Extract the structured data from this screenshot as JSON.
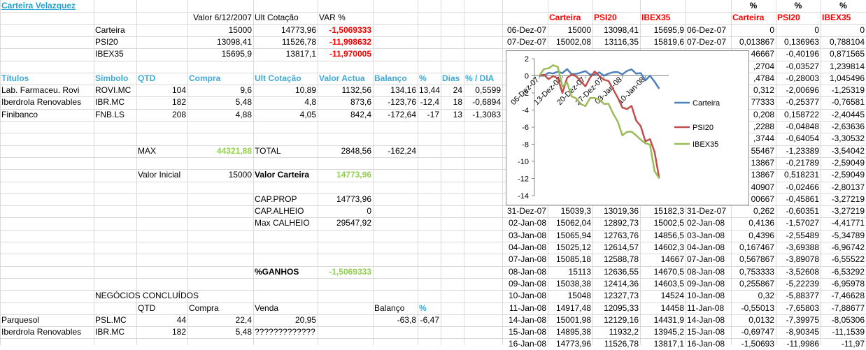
{
  "title": "Carteira Velazquez",
  "portfolio_header": {
    "valor_label": "Valor 6/12/2007",
    "ult_label": "Ult Cotação",
    "var_label": "VAR %"
  },
  "portfolio": [
    {
      "name": "Carteira",
      "valor": "15000",
      "ult": "14773,96",
      "var": "-1,5069333"
    },
    {
      "name": "PSI20",
      "valor": "13098,41",
      "ult": "11526,78",
      "var": "-11,998632"
    },
    {
      "name": "IBEX35",
      "valor": "15695,9",
      "ult": "13817,1",
      "var": "-11,970005"
    }
  ],
  "titulos_header": [
    "Títulos",
    "Símbolo",
    "QTD",
    "Compra",
    "Ult Cotação",
    "Valor Actua",
    "Balanço",
    "%",
    "Dias",
    "% / DIA"
  ],
  "titulos": [
    [
      "Lab. Farmaceu. Rovi",
      "ROVI.MC",
      "104",
      "9,6",
      "10,89",
      "1132,56",
      "134,16",
      "13,44",
      "24",
      "0,5599"
    ],
    [
      "Iberdrola Renovables",
      "IBR.MC",
      "182",
      "5,48",
      "4,8",
      "873,6",
      "-123,76",
      "-12,4",
      "18",
      "-0,6894"
    ],
    [
      "Finibanco",
      "FNB.LS",
      "208",
      "4,88",
      "4,05",
      "842,4",
      "-172,64",
      "-17",
      "13",
      "-1,3083"
    ]
  ],
  "max": {
    "label": "MAX",
    "value": "44321,88",
    "total_label": "TOTAL",
    "total": "2848,56",
    "total_bal": "-162,24"
  },
  "valor_inicial": {
    "label": "Valor Inicial",
    "value": "15000",
    "carteira_label": "Valor Carteira",
    "carteira": "14773,96"
  },
  "cap": [
    {
      "label": "CAP.PROP",
      "value": "14773,96"
    },
    {
      "label": "CAP.ALHEIO",
      "value": "0"
    },
    {
      "label": "Max CALHEIO",
      "value": "29547,92"
    }
  ],
  "ganhos": {
    "label": "%GANHOS",
    "value": "-1,5069333"
  },
  "negocios": {
    "title": "NEGÓCIOS CONCLUÍDOS",
    "header": {
      "qtd": "QTD",
      "compra": "Compra",
      "venda": "Venda",
      "balanco": "Balanço",
      "pct": "%"
    },
    "rows": [
      {
        "name": "Parquesol",
        "sym": "PSL.MC",
        "qtd": "44",
        "compra": "22,4",
        "venda": "20,95",
        "balanco": "-63,8",
        "pct": "-6,47"
      },
      {
        "name": "Iberdrola Renovables",
        "sym": "IBR.MC",
        "qtd": "182",
        "compra": "5,48",
        "venda": "?????????????",
        "balanco": "",
        "pct": ""
      }
    ]
  },
  "right_header": {
    "carteira": "Carteira",
    "psi20": "PSI20",
    "ibex35": "IBEX35",
    "pct": "%",
    "pcarteira": "Carteira",
    "ppsi20": "PSI20",
    "pibex35": "IBEX35"
  },
  "right_rows": [
    {
      "date": "06-Dez-07",
      "c": "15000",
      "p": "13098,41",
      "i": "15695,9",
      "date2": "06-Dez-07",
      "pc": "0",
      "pp": "0",
      "pi": "0"
    },
    {
      "date": "07-Dez-07",
      "c": "15002,08",
      "p": "13116,35",
      "i": "15819,6",
      "date2": "07-Dez-07",
      "pc": "0,013867",
      "pp": "0,136963",
      "pi": "0,788104"
    },
    {
      "date": "",
      "c": "",
      "p": "",
      "i": "",
      "date2": "",
      "pc": "46667",
      "pp": "-0,40196",
      "pi": "0,871565"
    },
    {
      "date": "",
      "c": "",
      "p": "",
      "i": "",
      "date2": "",
      "pc": ",2704",
      "pp": "-0,03527",
      "pi": "1,239814"
    },
    {
      "date": "",
      "c": "",
      "p": "",
      "i": "",
      "date2": "",
      "pc": ",4784",
      "pp": "-0,28003",
      "pi": "1,045496"
    },
    {
      "date": "",
      "c": "",
      "p": "",
      "i": "",
      "date2": "",
      "pc": "0,312",
      "pp": "-2,00696",
      "pi": "-1,25319"
    },
    {
      "date": "",
      "c": "",
      "p": "",
      "i": "",
      "date2": "",
      "pc": "77333",
      "pp": "-0,25377",
      "pi": "-0,76581"
    },
    {
      "date": "",
      "c": "",
      "p": "",
      "i": "",
      "date2": "",
      "pc": "0,208",
      "pp": "0,158722",
      "pi": "-2,40445"
    },
    {
      "date": "",
      "c": "",
      "p": "",
      "i": "",
      "date2": "",
      "pc": ",2288",
      "pp": "-0,04848",
      "pi": "-2,63636"
    },
    {
      "date": "",
      "c": "",
      "p": "",
      "i": "",
      "date2": "",
      "pc": ",3744",
      "pp": "-0,64054",
      "pi": "-3,30532"
    },
    {
      "date": "",
      "c": "",
      "p": "",
      "i": "",
      "date2": "",
      "pc": "55467",
      "pp": "-1,23389",
      "pi": "-3,54042"
    },
    {
      "date": "",
      "c": "",
      "p": "",
      "i": "",
      "date2": "",
      "pc": "13867",
      "pp": "-0,21789",
      "pi": "-2,59049"
    },
    {
      "date": "",
      "c": "",
      "p": "",
      "i": "",
      "date2": "",
      "pc": "13867",
      "pp": "0,518231",
      "pi": "-2,59049"
    },
    {
      "date": "",
      "c": "",
      "p": "",
      "i": "",
      "date2": "",
      "pc": "40907",
      "pp": "-0,02466",
      "pi": "-2,80137"
    },
    {
      "date": "",
      "c": "",
      "p": "",
      "i": "",
      "date2": "",
      "pc": "00667",
      "pp": "-0,45861",
      "pi": "-3,27219"
    },
    {
      "date": "31-Dez-07",
      "c": "15039,3",
      "p": "13019,36",
      "i": "15182,3",
      "date2": "31-Dez-07",
      "pc": "0,262",
      "pp": "-0,60351",
      "pi": "-3,27219"
    },
    {
      "date": "02-Jan-08",
      "c": "15062,04",
      "p": "12892,73",
      "i": "15002,5",
      "date2": "02-Jan-08",
      "pc": "0,4136",
      "pp": "-1,57027",
      "pi": "-4,41771"
    },
    {
      "date": "03-Jan-08",
      "c": "15065,94",
      "p": "12763,76",
      "i": "14856,5",
      "date2": "03-Jan-08",
      "pc": "0,4396",
      "pp": "-2,55489",
      "pi": "-5,34789"
    },
    {
      "date": "04-Jan-08",
      "c": "15025,12",
      "p": "12614,57",
      "i": "14602,3",
      "date2": "04-Jan-08",
      "pc": "0,167467",
      "pp": "-3,69388",
      "pi": "-6,96742"
    },
    {
      "date": "07-Jan-08",
      "c": "15085,18",
      "p": "12588,78",
      "i": "14667",
      "date2": "07-Jan-08",
      "pc": "0,567867",
      "pp": "-3,89078",
      "pi": "-6,55522"
    },
    {
      "date": "08-Jan-08",
      "c": "15113",
      "p": "12636,55",
      "i": "14670,5",
      "date2": "08-Jan-08",
      "pc": "0,753333",
      "pp": "-3,52608",
      "pi": "-6,53292"
    },
    {
      "date": "09-Jan-08",
      "c": "15038,38",
      "p": "12414,36",
      "i": "14603,5",
      "date2": "09-Jan-08",
      "pc": "0,255867",
      "pp": "-5,22239",
      "pi": "-6,95978"
    },
    {
      "date": "10-Jan-08",
      "c": "15048",
      "p": "12327,73",
      "i": "14524",
      "date2": "10-Jan-08",
      "pc": "0,32",
      "pp": "-5,88377",
      "pi": "-7,46628"
    },
    {
      "date": "11-Jan-08",
      "c": "14917,48",
      "p": "12095,33",
      "i": "14458",
      "date2": "11-Jan-08",
      "pc": "-0,55013",
      "pp": "-7,65803",
      "pi": "-7,88677"
    },
    {
      "date": "14-Jan-08",
      "c": "15001,98",
      "p": "12129,16",
      "i": "14431,9",
      "date2": "14-Jan-08",
      "pc": "0,0132",
      "pp": "-7,39975",
      "pi": "-8,05306"
    },
    {
      "date": "15-Jan-08",
      "c": "14895,38",
      "p": "11932,2",
      "i": "13945,2",
      "date2": "15-Jan-08",
      "pc": "-0,69747",
      "pp": "-8,90345",
      "pi": "-11,1539"
    },
    {
      "date": "16-Jan-08",
      "c": "14773,96",
      "p": "11526,78",
      "i": "13817,1",
      "date2": "16-Jan-08",
      "pc": "-1,50693",
      "pp": "-11,9986",
      "pi": "-11,97"
    }
  ],
  "colors": {
    "carteira": "#4f81bd",
    "psi20": "#c0504d",
    "ibex35": "#9bbb59",
    "header": "#3fa9d6",
    "red": "#ff0000",
    "green": "#92d050"
  },
  "chart_data": {
    "type": "line",
    "x": [
      "06-Dez-07",
      "07-Dez-07",
      "10-Dez-07",
      "11-Dez-07",
      "12-Dez-07",
      "13-Dez-07",
      "14-Dez-07",
      "17-Dez-07",
      "18-Dez-07",
      "19-Dez-07",
      "20-Dez-07",
      "21-Dez-07",
      "24-Dez-07",
      "26-Dez-07",
      "27-Dez-07",
      "28-Dez-07",
      "31-Dez-07",
      "02-Jan-08",
      "03-Jan-08",
      "04-Jan-08",
      "07-Jan-08",
      "08-Jan-08",
      "09-Jan-08",
      "10-Jan-08",
      "11-Jan-08",
      "14-Jan-08",
      "15-Jan-08",
      "16-Jan-08"
    ],
    "x_tick_labels": [
      "06-Dez-07",
      "13-Dez-07",
      "20-Dez-07",
      "27-Dez-07",
      "03-Jan-08",
      "10-Jan-08"
    ],
    "series": [
      {
        "name": "Carteira",
        "values": [
          0,
          0.014,
          0.347,
          0.27,
          0.478,
          0.312,
          0.773,
          0.208,
          0.229,
          0.374,
          0.555,
          0.139,
          0.139,
          0.409,
          0.007,
          0.262,
          0.414,
          0.44,
          0.167,
          0.568,
          0.753,
          0.256,
          0.32,
          -0.55,
          0.013,
          -0.697,
          -1.507
        ]
      },
      {
        "name": "PSI20",
        "values": [
          0,
          0.137,
          -0.402,
          -0.035,
          -0.28,
          -2.007,
          -0.254,
          0.159,
          -0.048,
          -0.641,
          -1.234,
          -0.218,
          0.518,
          -0.025,
          -0.459,
          -0.604,
          -1.57,
          -2.555,
          -3.694,
          -3.891,
          -3.526,
          -5.222,
          -5.884,
          -7.658,
          -7.4,
          -8.903,
          -11.999
        ]
      },
      {
        "name": "IBEX35",
        "values": [
          0,
          0.788,
          0.872,
          1.24,
          1.045,
          -1.253,
          -0.766,
          -2.404,
          -2.636,
          -3.305,
          -3.54,
          -2.59,
          -2.59,
          -2.801,
          -3.272,
          -3.272,
          -4.418,
          -5.348,
          -6.967,
          -6.555,
          -6.533,
          -6.96,
          -7.466,
          -7.887,
          -8.053,
          -11.154,
          -11.97
        ]
      }
    ],
    "y_ticks": [
      "2",
      "0",
      "-2",
      "-4",
      "-6",
      "-8",
      "-10",
      "-12",
      "-14"
    ],
    "ylim": [
      -14,
      2
    ],
    "legend": "right"
  }
}
